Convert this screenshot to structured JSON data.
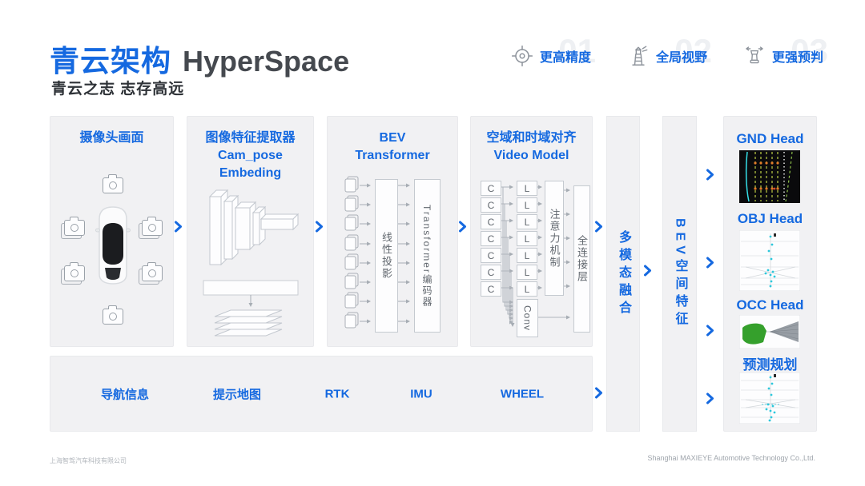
{
  "slide": {
    "title_cn": "青云架构",
    "title_en": "HyperSpace",
    "subtitle": "青云之志 志存高远"
  },
  "features": [
    {
      "num": "01",
      "label": "更高精度",
      "icon": "target-icon"
    },
    {
      "num": "02",
      "label": "全局视野",
      "icon": "lighthouse-icon"
    },
    {
      "num": "03",
      "label": "更强预判",
      "icon": "strategy-icon"
    }
  ],
  "panels": {
    "camera": {
      "title": "摄像头画面"
    },
    "extractor": {
      "title1": "图像特征提取器",
      "title2": "Cam_pose",
      "title3": "Embeding"
    },
    "bev": {
      "title1": "BEV",
      "title2": "Transformer",
      "linear_proj": "线性投影",
      "encoder": "Transformer编码器"
    },
    "video": {
      "title1": "空域和时域对齐",
      "title2": "Video Model",
      "c": "C",
      "l": "L",
      "attention": "注意力机制",
      "fc": "全连接层",
      "conv": "Conv"
    }
  },
  "bars": {
    "fusion": "多模态融合",
    "bev_feature": "BEV空间特征"
  },
  "heads": [
    {
      "label": "GND Head",
      "preview": "lane-lines-visualization"
    },
    {
      "label": "OBJ Head",
      "preview": "object-detection-visualization"
    },
    {
      "label": "OCC Head",
      "preview": "occupancy-visualization"
    },
    {
      "label": "预测规划",
      "preview": "prediction-planning-visualization"
    }
  ],
  "inputs": [
    "导航信息",
    "提示地图",
    "RTK",
    "IMU",
    "WHEEL"
  ],
  "footer": {
    "left": "上海智驾汽车科技有限公司",
    "right": "Shanghai MAXIEYE Automotive Technology Co.,Ltd."
  },
  "colors": {
    "accent": "#1569e0",
    "panel_bg": "#f1f1f3",
    "line_gray": "#b0b5bc"
  }
}
